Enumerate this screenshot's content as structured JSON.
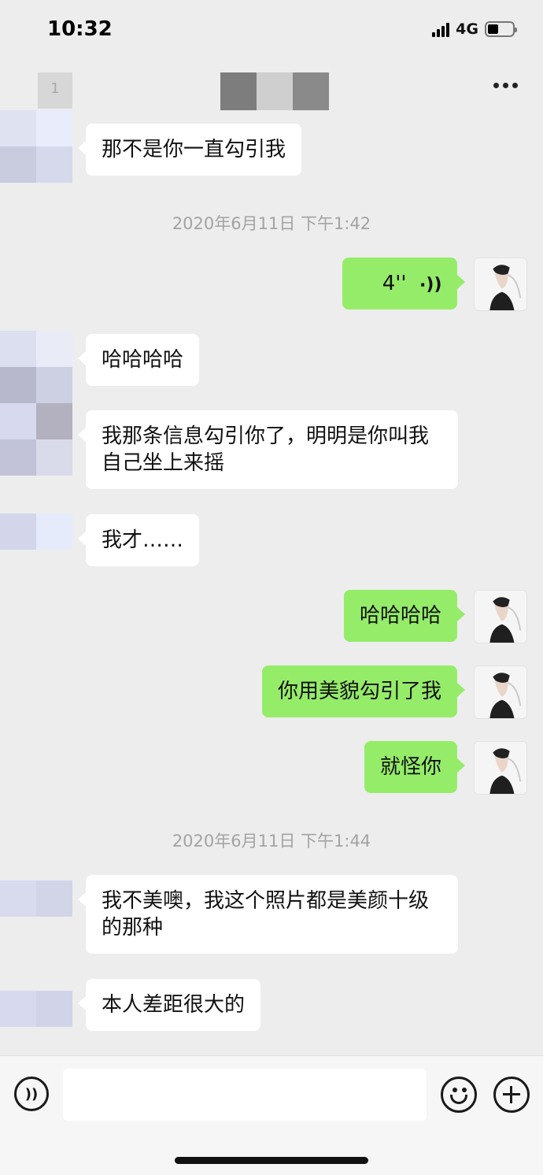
{
  "status_bar": {
    "time": "10:32",
    "network": "4G"
  },
  "nav": {
    "back_count": "1"
  },
  "messages": [
    {
      "type": "text",
      "side": "in",
      "text": "那不是你一直勾引我"
    },
    {
      "type": "timestamp",
      "text": "2020年6月11日 下午1:42"
    },
    {
      "type": "voice",
      "side": "out",
      "duration": "4''"
    },
    {
      "type": "text",
      "side": "in",
      "text": "哈哈哈哈"
    },
    {
      "type": "text",
      "side": "in",
      "text": "我那条信息勾引你了，明明是你叫我自己坐上来摇"
    },
    {
      "type": "text",
      "side": "in",
      "text": "我才……"
    },
    {
      "type": "text",
      "side": "out",
      "text": "哈哈哈哈"
    },
    {
      "type": "text",
      "side": "out",
      "text": "你用美貌勾引了我"
    },
    {
      "type": "text",
      "side": "out",
      "text": "就怪你"
    },
    {
      "type": "timestamp",
      "text": "2020年6月11日 下午1:44"
    },
    {
      "type": "text",
      "side": "in",
      "text": "我不美噢，我这个照片都是美颜十级的那种"
    },
    {
      "type": "text",
      "side": "in",
      "text": "本人差距很大的"
    }
  ],
  "input": {
    "value": "",
    "placeholder": ""
  },
  "icons": {
    "more": "more-dots-icon",
    "voice": "voice-wave-icon",
    "emoji": "emoji-face-icon",
    "plus": "plus-circle-icon"
  },
  "colors": {
    "outgoing_bubble": "#95ec69",
    "incoming_bubble": "#ffffff",
    "background": "#ededed"
  }
}
